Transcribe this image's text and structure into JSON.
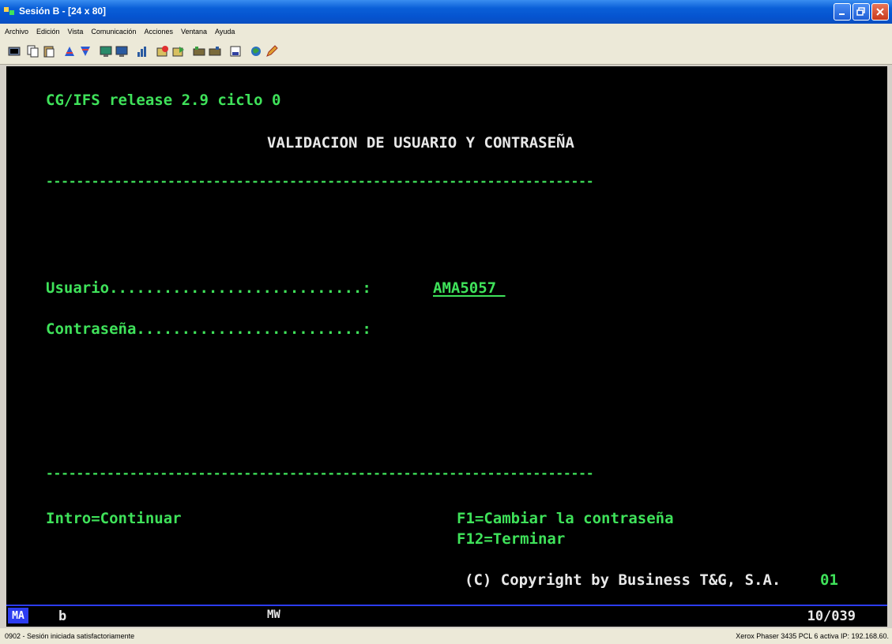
{
  "window": {
    "title": "Sesión B - [24 x 80]",
    "controls": [
      "minimize-icon",
      "maximize-icon",
      "close-icon"
    ]
  },
  "menu": [
    "Archivo",
    "Edición",
    "Vista",
    "Comunicación",
    "Acciones",
    "Ventana",
    "Ayuda"
  ],
  "toolbar_icons": [
    "print-screen-icon",
    "copy-icon",
    "paste-icon",
    "send-icon",
    "receive-icon",
    "display-icon",
    "display-2-icon",
    "chart-icon",
    "macro-record-icon",
    "macro-play-icon",
    "keyboard-icon",
    "keypad-icon",
    "help-icon",
    "globe-icon",
    "edit-icon"
  ],
  "terminal": {
    "release": "CG/IFS release 2.9 ciclo 0",
    "heading": "VALIDACION DE USUARIO Y CONTRASEÑA",
    "separator": "------------------------------------------------------------------------",
    "user_label": "Usuario............................: ",
    "user_value": "AMA5057 ",
    "password_label": "Contraseña.........................:",
    "password_value": "",
    "key_enter": "Intro=Continuar",
    "key_f1": "F1=Cambiar la contraseña",
    "key_f12": "F12=Terminar",
    "copyright": "(C) Copyright by Business T&G, S.A.",
    "copyright_code": "01"
  },
  "operator_info": {
    "ma": "MA",
    "indicator": "b",
    "mw": "MW",
    "cursor_position": "10/039"
  },
  "status": {
    "message": "0902 - Sesión iniciada satisfactoriamente",
    "printer": "Xerox Phaser 3435 PCL 6 activa IP: 192.168.60."
  },
  "colors": {
    "terminal_bg": "#000000",
    "terminal_green": "#3fe25a",
    "terminal_white": "#e8e8e8",
    "title_blue": "#0554d0"
  }
}
